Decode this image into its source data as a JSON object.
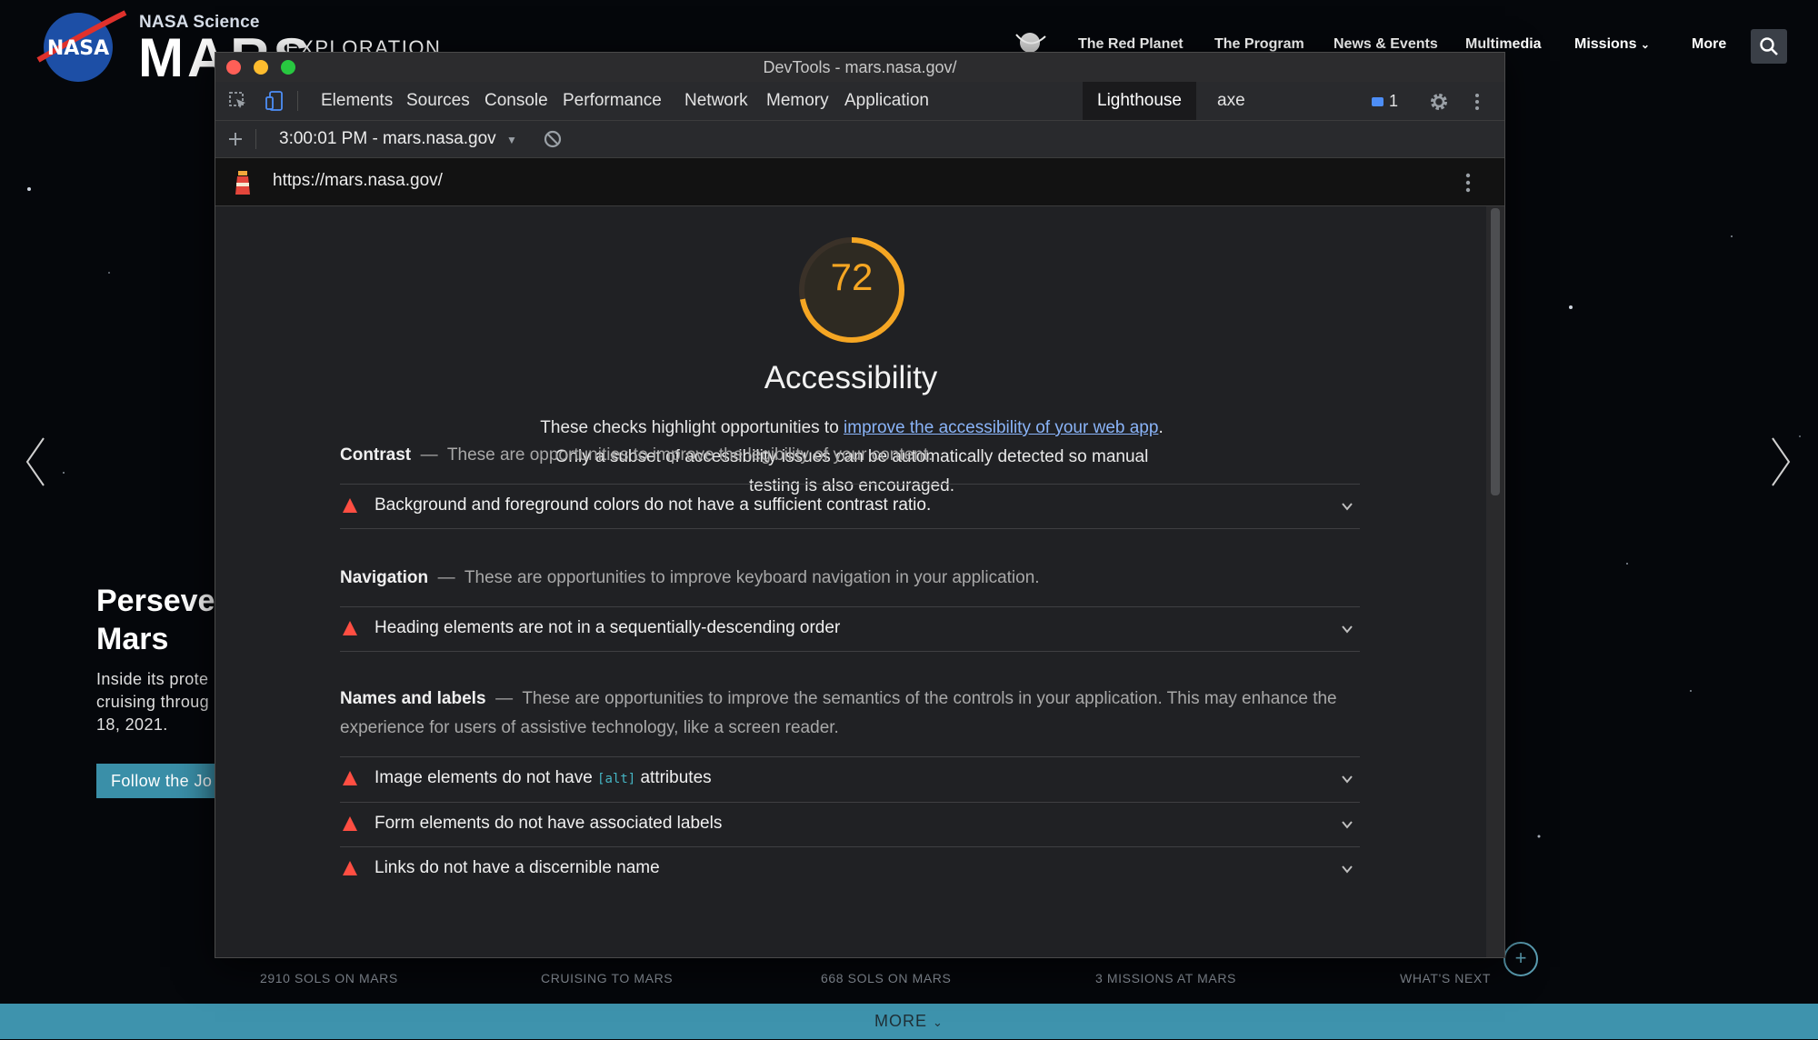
{
  "site": {
    "brand_top": "NASA Science",
    "brand_main": "MARS",
    "brand_sub": "EXPLORATION",
    "nav": [
      "The Red Planet",
      "The Program",
      "News & Events",
      "Multimedia",
      "Missions",
      "More"
    ],
    "hero_title_1": "Perseve",
    "hero_title_2": "Mars",
    "hero_text_1": "Inside its prote",
    "hero_text_2": "cruising throug",
    "hero_text_3": "18, 2021.",
    "hero_button": "Follow the Jo",
    "stats": [
      {
        "caption": "2910 SOLS ON MARS"
      },
      {
        "caption": "CRUISING TO MARS"
      },
      {
        "caption": "668 SOLS ON MARS"
      },
      {
        "caption": "3 MISSIONS AT MARS"
      },
      {
        "caption": "WHAT'S NEXT"
      }
    ],
    "more_bar": "MORE"
  },
  "devtools": {
    "window_title": "DevTools - mars.nasa.gov/",
    "tabs": [
      "Elements",
      "Sources",
      "Console",
      "Performance",
      "Network",
      "Memory",
      "Application",
      "Lighthouse",
      "axe"
    ],
    "active_tab": "Lighthouse",
    "issues_count": "1",
    "report_selector": "3:00:01 PM - mars.nasa.gov",
    "url": "https://mars.nasa.gov/",
    "colors": {
      "score": "#f5a623",
      "fail": "#ff4e42",
      "link": "#8ab4f8"
    }
  },
  "report": {
    "score": 72,
    "score_fraction": 0.72,
    "category_title": "Accessibility",
    "desc_before": "These checks highlight opportunities to ",
    "desc_link": "improve the accessibility of your web app",
    "desc_after": ". Only a subset of accessibility issues can be automatically detected so manual testing is also encouraged.",
    "groups": [
      {
        "title": "Contrast",
        "description": "These are opportunities to improve the legibility of your content.",
        "audits": [
          "Background and foreground colors do not have a sufficient contrast ratio."
        ]
      },
      {
        "title": "Navigation",
        "description": "These are opportunities to improve keyboard navigation in your application.",
        "audits": [
          "Heading elements are not in a sequentially-descending order"
        ]
      },
      {
        "title": "Names and labels",
        "description": "These are opportunities to improve the semantics of the controls in your application. This may enhance the experience for users of assistive technology, like a screen reader.",
        "audits": [
          "Form elements do not have associated labels",
          "Links do not have a discernible name"
        ]
      }
    ],
    "img_audit": {
      "before": "Image elements do not have ",
      "code": "[alt]",
      "after": " attributes"
    }
  }
}
